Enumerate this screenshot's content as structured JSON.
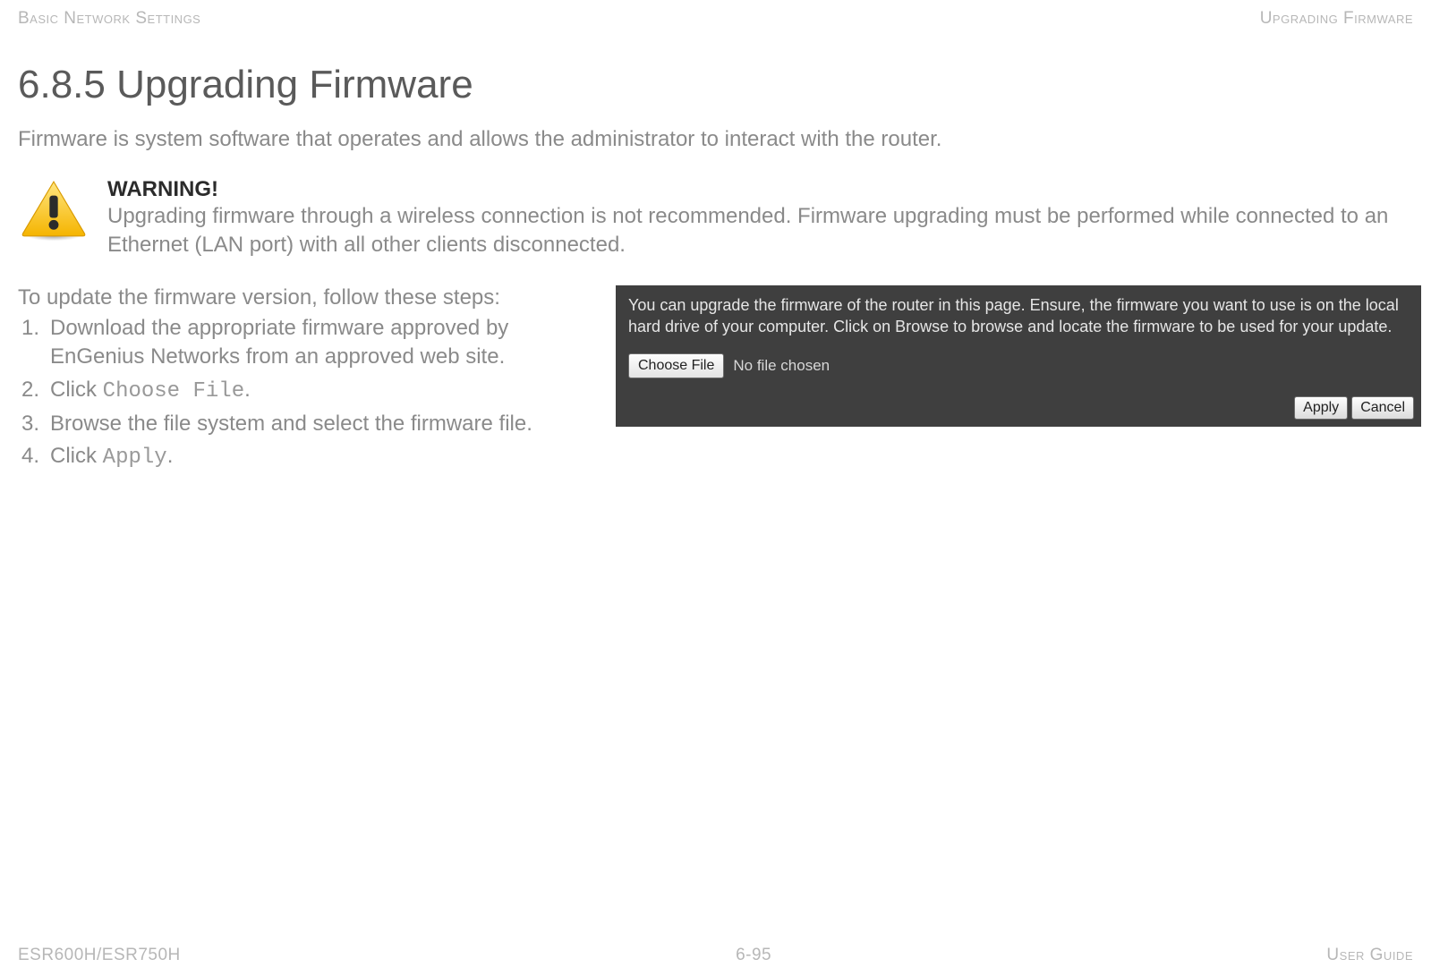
{
  "header": {
    "left": "Basic Network Settings",
    "right": "Upgrading Firmware"
  },
  "title": "6.8.5 Upgrading Firmware",
  "intro": "Firmware is system software that operates and allows the administrator to interact with the router.",
  "warning": {
    "label": "WARNING!",
    "text": "Upgrading firmware through a wireless connection is not recommended. Firmware upgrading must be performed while connected to an Ethernet (LAN port) with all other clients disconnected."
  },
  "steps": {
    "intro": "To update the firmware version, follow these steps:",
    "items": [
      {
        "pre": "Download the appropriate firmware approved by EnGenius Networks from an approved web site."
      },
      {
        "pre": "Click ",
        "mono": "Choose File",
        "post": "."
      },
      {
        "pre": "Browse the file system and select the firmware file."
      },
      {
        "pre": "Click ",
        "mono": "Apply",
        "post": "."
      }
    ]
  },
  "panel": {
    "description": "You can upgrade the firmware of the router in this page. Ensure, the firmware you want to use is on the local hard drive of your computer. Click on Browse to browse and locate the firmware to be used for your update.",
    "choose_file_label": "Choose File",
    "no_file_text": "No file chosen",
    "apply_label": "Apply",
    "cancel_label": "Cancel"
  },
  "footer": {
    "left": "ESR600H/ESR750H",
    "center": "6-95",
    "right": "User Guide"
  }
}
